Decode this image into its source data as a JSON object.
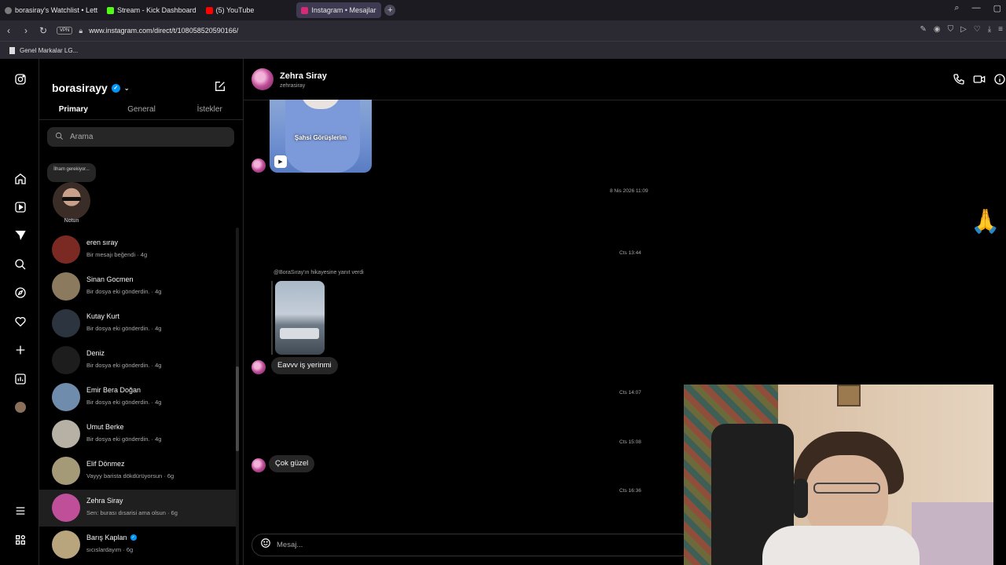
{
  "browser": {
    "tabs": [
      {
        "label": "borasiray's Watchlist • Lett",
        "color": "#7b7b7b"
      },
      {
        "label": "Stream - Kick Dashboard",
        "color": "#53fc18"
      },
      {
        "label": "(5) YouTube",
        "color": "#ff0000"
      },
      {
        "label": "Instagram • Mesajlar",
        "color": "#d62976"
      }
    ],
    "url": "www.instagram.com/direct/t/108058520590166/",
    "vpn": "VPN",
    "bookmark": "Genel Markalar LG..."
  },
  "inbox": {
    "username": "borasirayy",
    "tabs": [
      "Primary",
      "General",
      "İstekler"
    ],
    "search_placeholder": "Arama",
    "note_text": "İlham gerekiyor...",
    "note_label": "Notun",
    "conversations": [
      {
        "name": "eren sıray",
        "preview": "Bir mesajı beğendi · 4g",
        "color": "#7a2a22",
        "verified": false
      },
      {
        "name": "Sinan Gocmen",
        "preview": "Bir dosya eki gönderdin. · 4g",
        "color": "#8c7a5e",
        "verified": false
      },
      {
        "name": "Kutay Kurt",
        "preview": "Bir dosya eki gönderdin. · 4g",
        "color": "#2c3440",
        "verified": false
      },
      {
        "name": "Deniz",
        "preview": "Bir dosya eki gönderdin. · 4g",
        "color": "#1d1d1d",
        "verified": false
      },
      {
        "name": "Emir Bera Doğan",
        "preview": "Bir dosya eki gönderdin. · 4g",
        "color": "#6f8cad",
        "verified": false
      },
      {
        "name": "Umut Berke",
        "preview": "Bir dosya eki gönderdin. · 4g",
        "color": "#b7b0a4",
        "verified": false
      },
      {
        "name": "Elif Dönmez",
        "preview": "Vayyy barista dökdürüyorsun · 6g",
        "color": "#a59a78",
        "verified": false
      },
      {
        "name": "Zehra Siray",
        "preview": "Sen: burası dısarisi ama olsun · 6g",
        "color": "#c04f9a",
        "verified": false
      },
      {
        "name": "Barış Kaplan",
        "preview": "sıcıslardayım · 6g",
        "color": "#b8a57e",
        "verified": true
      }
    ]
  },
  "chat": {
    "name": "Zehra Siray",
    "handle": "zehrasiray",
    "reel_caption": "Şahsi Görüşlerim",
    "timestamps": [
      "8 Nis 2026 11:09",
      "Cts 13:44",
      "Cts 14:07",
      "Cts 15:08",
      "Cts 16:36"
    ],
    "reply_label": "@BoraSıray'ın hikayesine yanıt verdi",
    "messages": [
      "Eavvv iş yerinmi",
      "Çok güzel"
    ],
    "reaction": "🙏",
    "composer_placeholder": "Mesaj..."
  }
}
